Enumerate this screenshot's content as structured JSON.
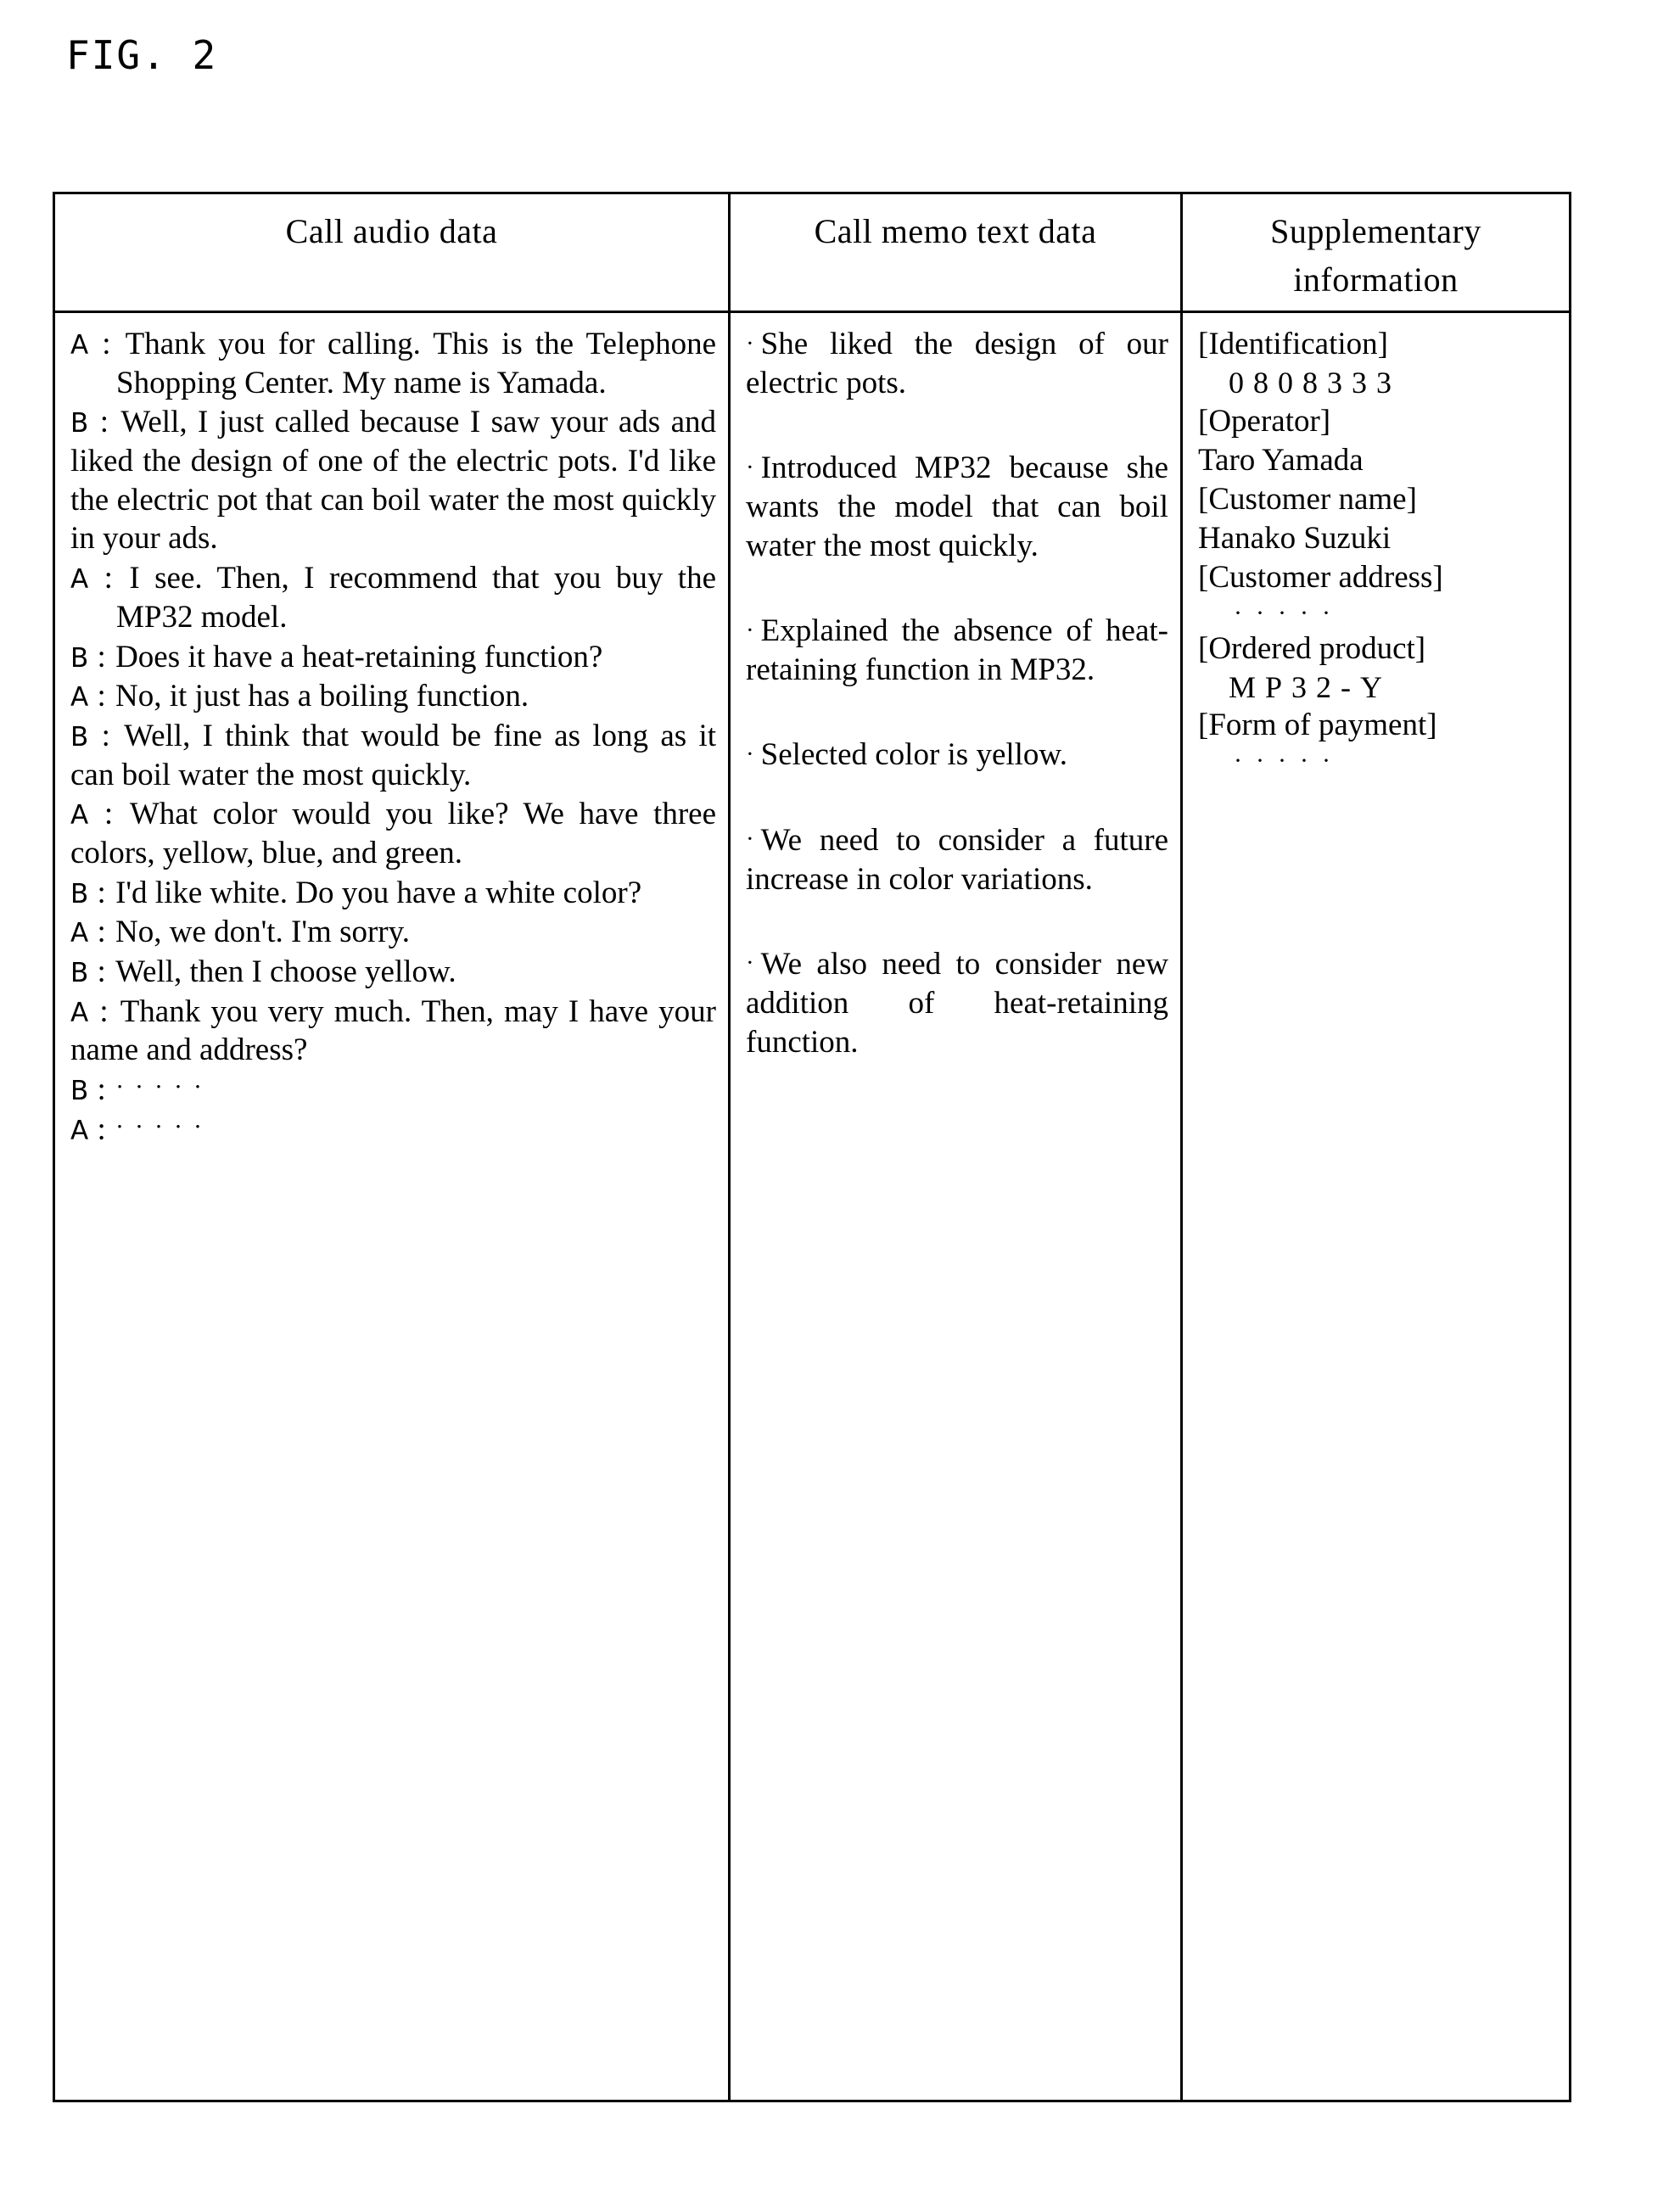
{
  "figure": {
    "label": "FIG. 2"
  },
  "table": {
    "headers": [
      {
        "lines": [
          "Call audio data"
        ]
      },
      {
        "lines": [
          "Call memo text data"
        ]
      },
      {
        "lines": [
          "Supplementary",
          "information"
        ]
      }
    ],
    "call_audio_data": {
      "turns": [
        {
          "speaker": "A",
          "text": "Thank you for calling.   This is the Telephone Shopping Center.   My name is Yamada.",
          "indent": true
        },
        {
          "speaker": "B",
          "text": "Well, I just called because I saw your ads and liked the design of one of the electric pots.   I'd like the electric pot that can boil water the most quickly in your ads.",
          "indent": false
        },
        {
          "speaker": "A",
          "text": "I see.   Then, I recommend that you buy the MP32 model.",
          "indent": true
        },
        {
          "speaker": "B",
          "text": "Does it have a heat-retaining function?",
          "indent": false
        },
        {
          "speaker": "A",
          "text": "No, it just has a boiling function.",
          "indent": false
        },
        {
          "speaker": "B",
          "text": "Well, I think that would be fine as long as it can boil water the most quickly.",
          "indent": false
        },
        {
          "speaker": "A",
          "text": "What color would you like?   We have three colors, yellow, blue, and green.",
          "indent": false
        },
        {
          "speaker": "B",
          "text": "I'd like white.   Do you have a white color?",
          "indent": false
        },
        {
          "speaker": "A",
          "text": "No, we don't.   I'm sorry.",
          "indent": false
        },
        {
          "speaker": "B",
          "text": "Well, then I choose yellow.",
          "indent": false
        },
        {
          "speaker": "A",
          "text": "Thank you very much.   Then, may I have your name and address?",
          "indent": false
        },
        {
          "speaker": "B",
          "text": "·····",
          "indent": false,
          "is_ellipsis": true
        },
        {
          "speaker": "A",
          "text": "·····",
          "indent": false,
          "is_ellipsis": true
        }
      ]
    },
    "call_memo_text_data": {
      "bullet": "·",
      "items": [
        "She liked the design of our electric pots.",
        "Introduced MP32 because she wants the model that can boil water the most quickly.",
        "Explained the absence of heat-retaining function in MP32.",
        "Selected color is yellow.",
        "We need to consider a future increase in color variations.",
        "We also need to consider new addition of heat-retaining function."
      ]
    },
    "supplementary_information": {
      "entries": [
        {
          "label": "[Identification]",
          "value": "0808333",
          "value_style": "wide"
        },
        {
          "label": "[Operator]",
          "value": "Taro Yamada",
          "value_style": "plain"
        },
        {
          "label": "[Customer name]",
          "value": "Hanako Suzuki",
          "value_style": "plain"
        },
        {
          "label": "[Customer address]",
          "value": "·····",
          "value_style": "dots"
        },
        {
          "label": "[Ordered product]",
          "value": "MP32-Y",
          "value_style": "wide"
        },
        {
          "label": "[Form of payment]",
          "value": "·····",
          "value_style": "dots"
        }
      ]
    }
  }
}
